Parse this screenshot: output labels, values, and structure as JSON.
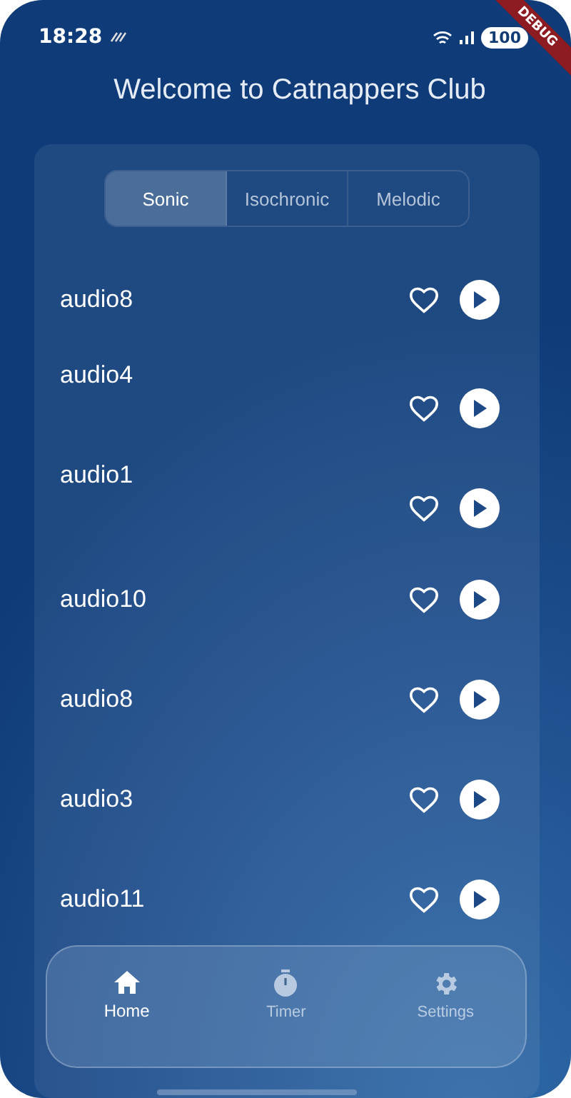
{
  "status_bar": {
    "time": "18:28",
    "battery": "100"
  },
  "debug_banner": "DEBUG",
  "title": "Welcome to Catnappers Club",
  "tabs": [
    {
      "label": "Sonic",
      "selected": true
    },
    {
      "label": "Isochronic",
      "selected": false
    },
    {
      "label": "Melodic",
      "selected": false
    }
  ],
  "tracks": [
    {
      "name": "audio8",
      "favorite": false,
      "kind": "centered"
    },
    {
      "name": "audio4",
      "favorite": false,
      "kind": "raised"
    },
    {
      "name": "audio1",
      "favorite": false,
      "kind": "raised"
    },
    {
      "name": "audio10",
      "favorite": false,
      "kind": "centered"
    },
    {
      "name": "audio8",
      "favorite": false,
      "kind": "centered"
    },
    {
      "name": "audio3",
      "favorite": false,
      "kind": "centered"
    },
    {
      "name": "audio11",
      "favorite": false,
      "kind": "centered"
    }
  ],
  "nav": [
    {
      "label": "Home",
      "selected": true
    },
    {
      "label": "Timer",
      "selected": false
    },
    {
      "label": "Settings",
      "selected": false
    }
  ]
}
